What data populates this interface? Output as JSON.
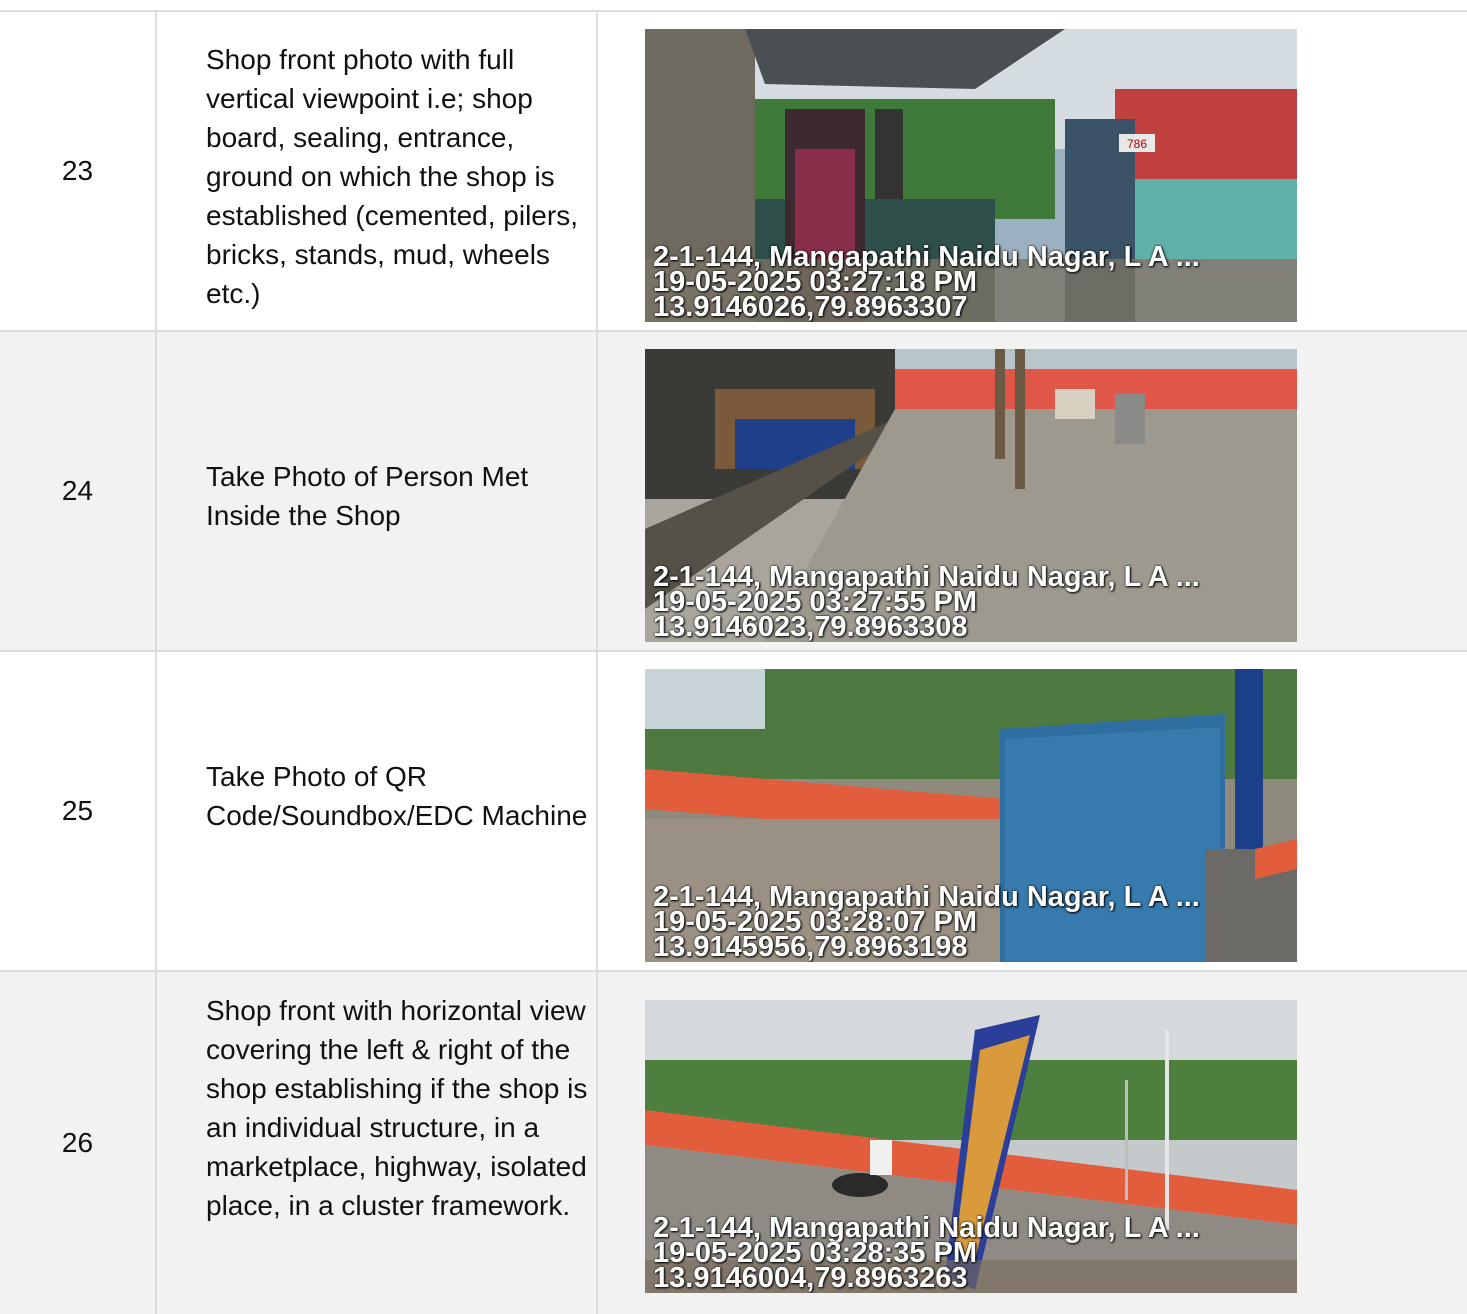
{
  "rows": [
    {
      "number": "23",
      "description": "Shop front photo with full vertical viewpoint i.e; shop board, sealing, entrance, ground on which the shop is established (cemented, pilers, bricks, stands, mud, wheels etc.)",
      "photo": {
        "address": "2-1-144, Mangapathi Naidu Nagar, L A ...",
        "datetime": "19-05-2025 03:27:18 PM",
        "coords": "13.9146026,79.8963307",
        "sign_text": "786"
      }
    },
    {
      "number": "24",
      "description": "Take Photo of Person Met Inside the Shop",
      "photo": {
        "address": "2-1-144, Mangapathi Naidu Nagar, L A ...",
        "datetime": "19-05-2025 03:27:55 PM",
        "coords": "13.9146023,79.8963308"
      }
    },
    {
      "number": "25",
      "description": "Take Photo of QR Code/Soundbox/EDC Machine",
      "photo": {
        "address": "2-1-144, Mangapathi Naidu Nagar, L A ...",
        "datetime": "19-05-2025 03:28:07 PM",
        "coords": "13.9145956,79.8963198"
      }
    },
    {
      "number": "26",
      "description": "Shop front with horizontal view covering the left & right of the shop establishing if the shop is an individual structure, in a marketplace, highway, isolated place, in a cluster framework.",
      "photo": {
        "address": "2-1-144, Mangapathi Naidu Nagar, L A ...",
        "datetime": "19-05-2025 03:28:35 PM",
        "coords": "13.9146004,79.8963263"
      }
    }
  ]
}
